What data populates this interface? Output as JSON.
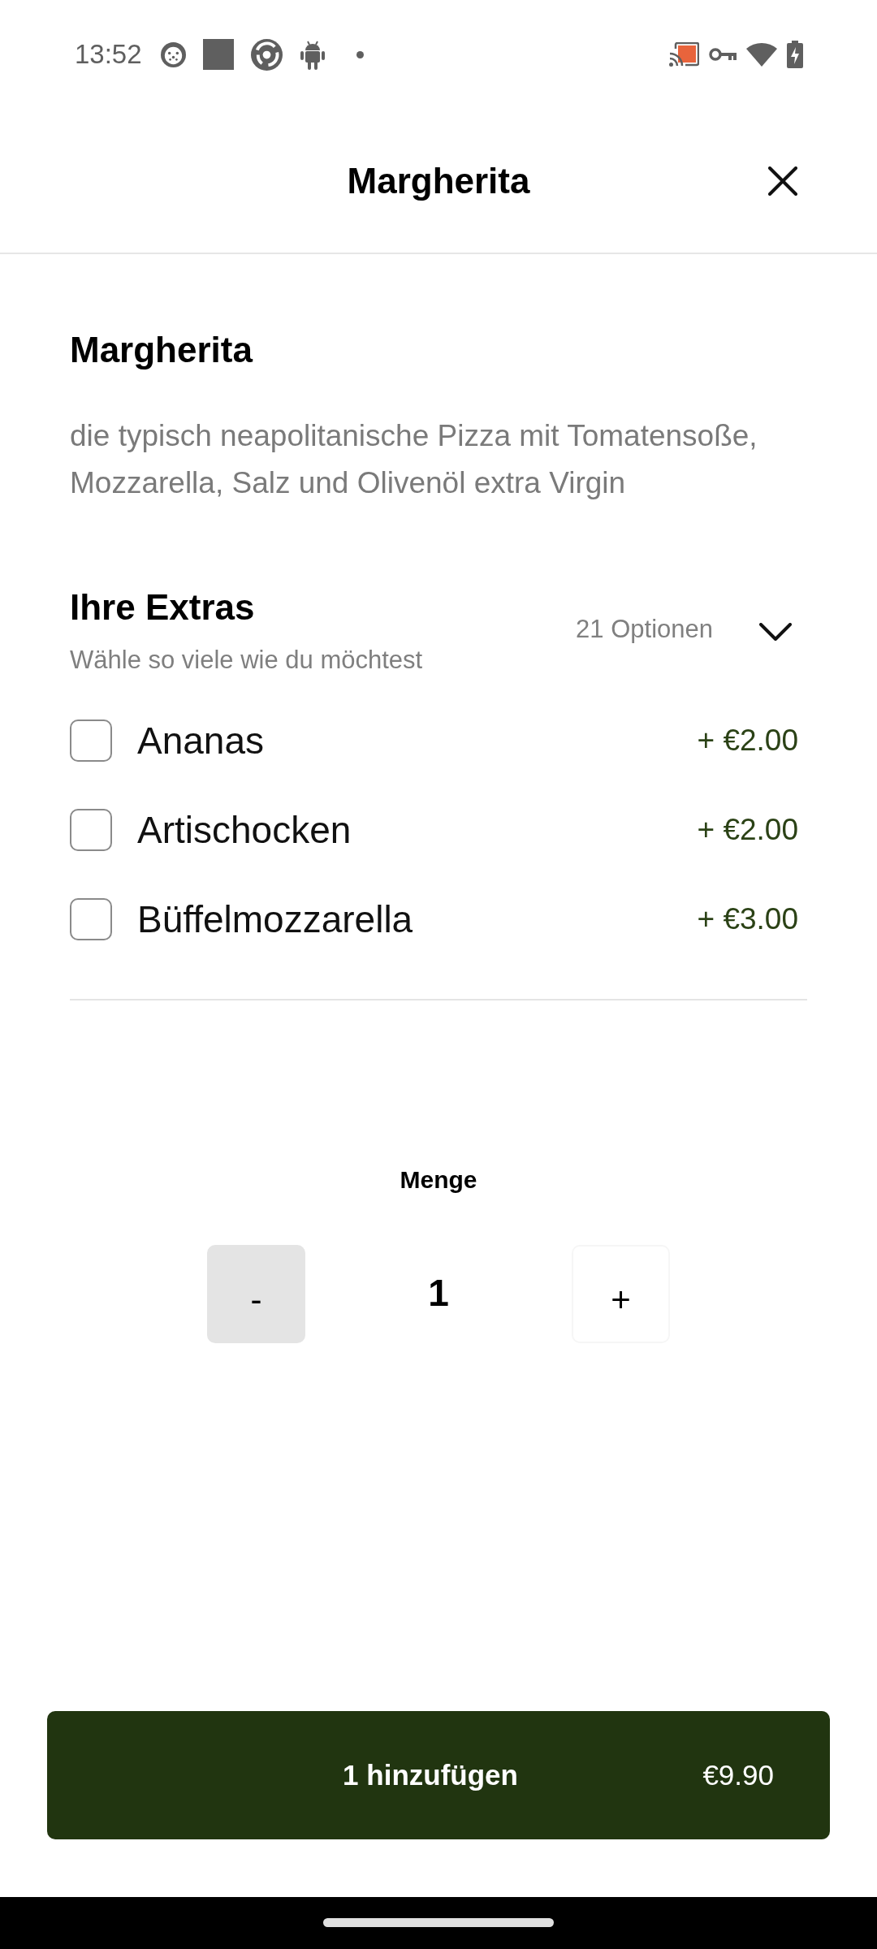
{
  "status_bar": {
    "time": "13:52"
  },
  "header": {
    "title": "Margherita"
  },
  "product": {
    "name": "Margherita",
    "description": "die typisch neapolitanische Pizza mit Tomatensoße, Mozzarella, Salz und Olivenöl extra Virgin"
  },
  "extras": {
    "title": "Ihre Extras",
    "subtitle": "Wähle so viele wie du möchtest",
    "option_count": "21 Optionen",
    "options": [
      {
        "label": "Ananas",
        "price": "+ €2.00",
        "checked": false
      },
      {
        "label": "Artischocken",
        "price": "+ €2.00",
        "checked": false
      },
      {
        "label": "Büffelmozzarella",
        "price": "+ €3.00",
        "checked": false
      }
    ]
  },
  "quantity": {
    "label": "Menge",
    "decrement": {
      "label": "-",
      "disabled": true
    },
    "value": "1",
    "increment": {
      "label": "+",
      "disabled": false
    }
  },
  "add_button": {
    "label": "1 hinzufügen",
    "price": "€9.90"
  }
}
